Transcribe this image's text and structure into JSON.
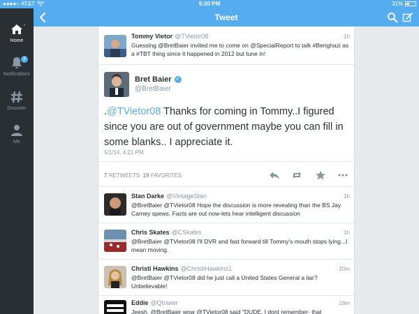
{
  "status_bar": {
    "carrier": "●●●●○ AT&T",
    "time": "5:30 PM",
    "battery_text": "31%",
    "battery_level": 0.31
  },
  "nav": {
    "title": "Tweet",
    "back_icon": "chevron-left-icon",
    "search_icon": "search-icon",
    "compose_icon": "compose-icon"
  },
  "sidebar": {
    "items": [
      {
        "label": "Home",
        "icon": "home-icon",
        "active": true
      },
      {
        "label": "Notifications",
        "icon": "bell-icon",
        "badge": "4"
      },
      {
        "label": "Discover",
        "icon": "hashtag-icon"
      },
      {
        "label": "Me",
        "icon": "person-icon"
      }
    ]
  },
  "colors": {
    "brand": "#55acee",
    "sidebar": "#292f33",
    "muted": "#8899a6"
  },
  "parent_tweet": {
    "name": "Tommy Vietor",
    "handle": "@TVietor08",
    "time": "1h",
    "text": "Guessing @BretBaier invited me to come on @SpecialReport to talk #Benghazi as a #TBT thing since it happened in 2012 but tune in!"
  },
  "main_tweet": {
    "name": "Bret Baier",
    "handle": "@BretBaier",
    "verified_icon": "verified-icon",
    "prefix": ".",
    "mention": "@TVietor08",
    "text": " Thanks for coming in Tommy..I figured since you are out of government maybe you can fill in some blanks..  I appreciate it.",
    "date": "5/1/14, 4:21 PM",
    "retweets_count": "7",
    "retweets_label": "RETWEETS",
    "favorites_count": "19",
    "favorites_label": "FAVORITES"
  },
  "replies": [
    {
      "name": "Stan Darke",
      "handle": "@VintageStan",
      "time": "1h",
      "text": "@BretBaier @TVietor08 Hope the discussion is more revealing than the BS Jay Carney spews. Facts are out now-lets hear intelligent discussion"
    },
    {
      "name": "Chris Skates",
      "handle": "@CSkates",
      "time": "1h",
      "text": "@BretBaier @TVietor08 I'll DVR and fast forward till Tommy's mouth stops lying...I mean moving."
    },
    {
      "name": "Christi Hawkins",
      "handle": "@ChristiHawkins1",
      "time": "20m",
      "text": "@BretBaier @TVietor08 did he just call a United States General a liar? Unbelievable!"
    },
    {
      "name": "Eddie",
      "handle": "@Qtraxer",
      "time": "16m",
      "text": "Jeesh, @BretBaier wow @TVietor08 said \"DUDE, I dont remember- that"
    }
  ]
}
